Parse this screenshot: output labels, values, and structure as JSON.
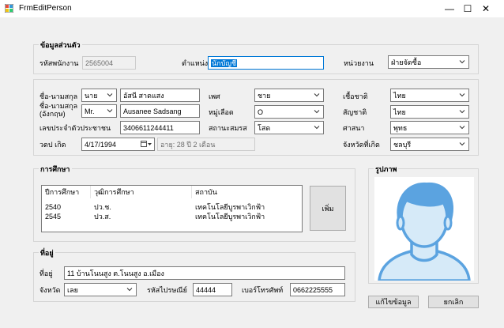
{
  "window": {
    "title": "FrmEditPerson",
    "minimize": "—",
    "maximize": "☐",
    "close": "✕"
  },
  "employee": {
    "group_title": "ข้อมูลส่วนตัว",
    "emp_id_label": "รหัสพนักงาน",
    "emp_id_value": "2565004",
    "position_label": "ตำแหน่ง",
    "position_value": "นักบัญชี",
    "dept_label": "หน่วยงาน",
    "dept_value": "ฝ่ายจัดซื้อ"
  },
  "personal": {
    "name_th_label": "ชื่อ-นามสกุล",
    "title_th": "นาย",
    "name_th": "อัสนี สาดแสง",
    "name_en_label_1": "ชื่อ-นามสกุล",
    "name_en_label_2": "(อังกฤษ)",
    "title_en": "Mr.",
    "name_en": "Ausanee Sadsang",
    "id_card_label": "เลขประจำตัวประชาชน",
    "id_card": "3406611244411",
    "dob_label": "วดป เกิด",
    "dob": "4/17/1994",
    "age": "อายุ: 28 ปี 2 เดือน",
    "gender_label": "เพศ",
    "gender": "ชาย",
    "blood_label": "หมู่เลือด",
    "blood": "O",
    "marital_label": "สถานะสมรส",
    "marital": "โสด",
    "race_label": "เชื้อชาติ",
    "race": "ไทย",
    "nationality_label": "สัญชาติ",
    "nationality": "ไทย",
    "religion_label": "ศาสนา",
    "religion": "พุทธ",
    "birth_province_label": "จังหวัดที่เกิด",
    "birth_province": "ชลบุรี"
  },
  "education": {
    "group_title": "การศึกษา",
    "columns": [
      "ปีการศึกษา",
      "วุฒิการศึกษา",
      "สถาบัน"
    ],
    "rows": [
      [
        "2540",
        "ปว.ช.",
        "เทคโนโลยีบูรพาเวิกฟ้า"
      ],
      [
        "2545",
        "ปว.ส.",
        "เทคโนโลยีบูรพาเวิกฟ้า"
      ]
    ],
    "add_button": "เพิ่ม"
  },
  "photo": {
    "group_title": "รูปภาพ"
  },
  "address": {
    "group_title": "ที่อยู่",
    "address_label": "ที่อยู่",
    "address_value": "11 บ้านโนนสูง ต.โนนสูง อ.เมือง",
    "province_label": "จังหวัด",
    "province_value": "เลย",
    "postcode_label": "รหัสไปรษณีย์",
    "postcode_value": "44444",
    "phone_label": "เบอร์โทรศัพท์",
    "phone_value": "0662225555"
  },
  "actions": {
    "edit_button": "แก้ไขข้อมูล",
    "cancel_button": "ยกเลิก"
  },
  "colors": {
    "focus": "#0078d7",
    "avatar": "#5ba3e0",
    "avatar_light": "#d6eaf8"
  }
}
